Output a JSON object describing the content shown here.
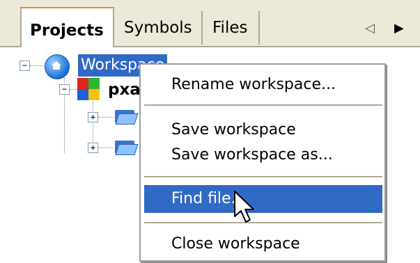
{
  "tabs": [
    {
      "label": "Projects"
    },
    {
      "label": "Symbols"
    },
    {
      "label": "Files"
    }
  ],
  "tab_nav": {
    "left_icon": "triangle-left-icon",
    "right_icon": "triangle-right-icon"
  },
  "tree": {
    "workspace_label": "Workspace",
    "project_label": "pxa",
    "expanders": {
      "collapse": "−",
      "expand": "+"
    }
  },
  "context_menu": {
    "items": [
      {
        "label": "Rename workspace..."
      },
      {
        "label": "Save workspace"
      },
      {
        "label": "Save workspace as..."
      },
      {
        "label": "Find file..."
      },
      {
        "label": "Close workspace"
      }
    ],
    "highlighted_index": 3
  },
  "colors": {
    "selection": "#316ac5",
    "active_tab_accent": "#e68b2c",
    "chrome": "#ece9d8"
  }
}
